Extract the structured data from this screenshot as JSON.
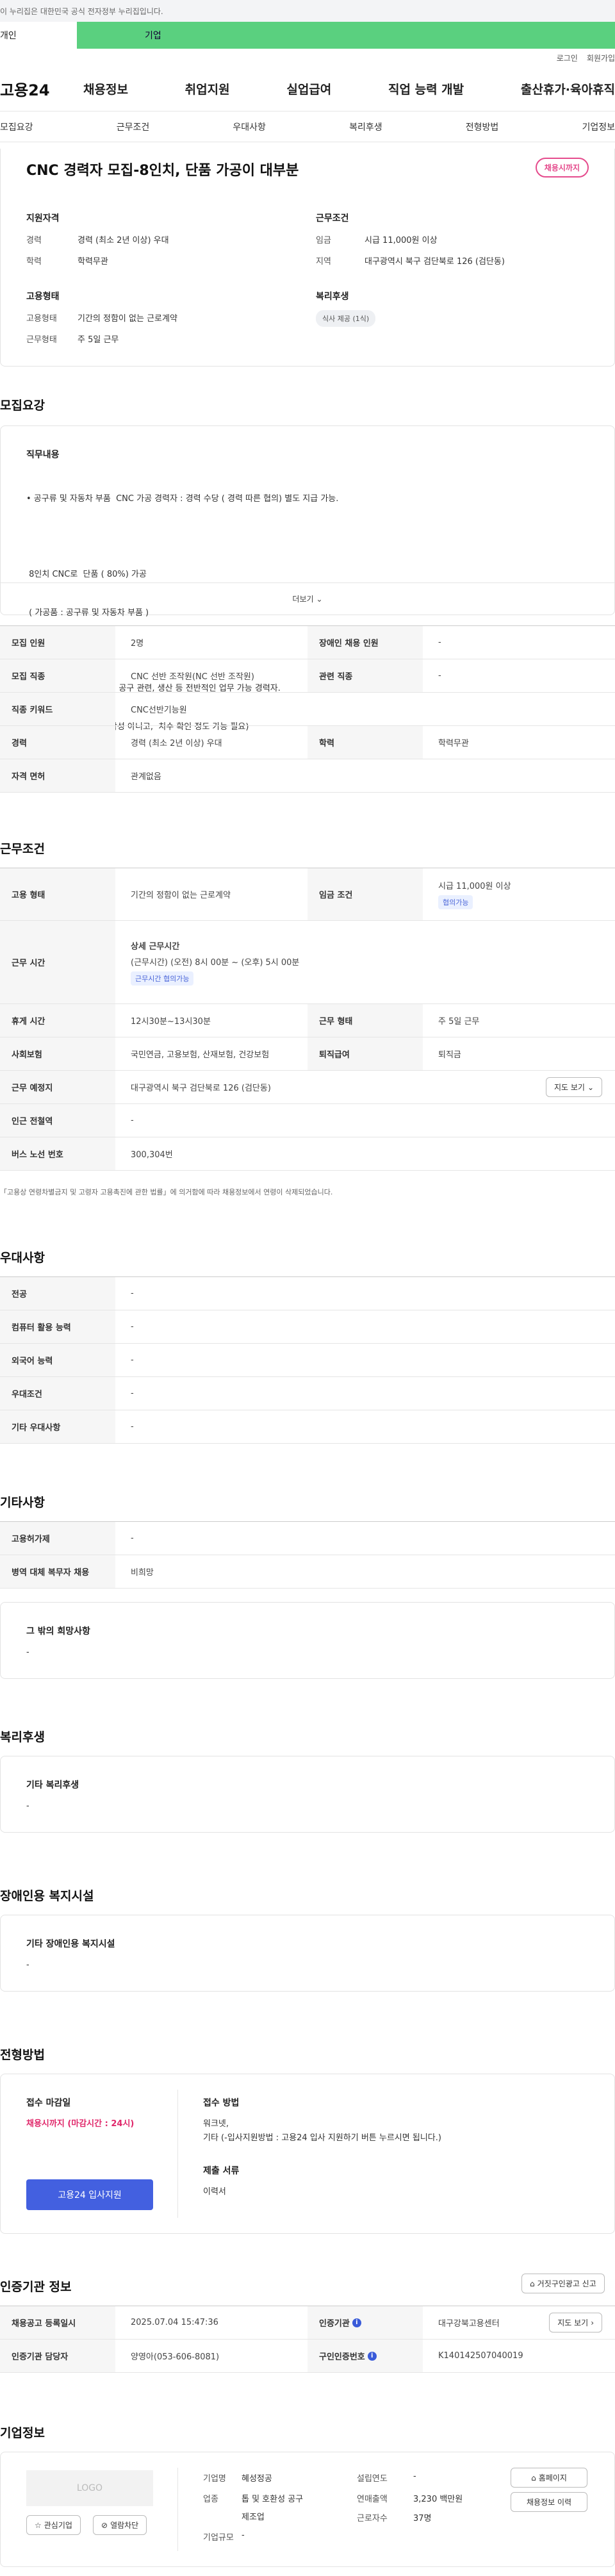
{
  "gov_banner": "이 누리집은 대한민국 공식 전자정부 누리집입니다.",
  "user_tabs": [
    "개인",
    "기업"
  ],
  "util_links": [
    "로그인",
    "회원가입"
  ],
  "logo": "고용24",
  "gnb": [
    "채용정보",
    "취업지원",
    "실업급여",
    "직업 능력 개발",
    "출산휴가·육아휴직"
  ],
  "anchors": [
    "모집요강",
    "근무조건",
    "우대사항",
    "복리후생",
    "전형방법",
    "기업정보"
  ],
  "summary": {
    "title": "CNC 경력자 모집-8인치, 단품 가공이 대부분",
    "badge": "채용시까지",
    "qual_title": "지원자격",
    "qual": [
      {
        "k": "경력",
        "v": "경력 (최소 2년 이상) 우대"
      },
      {
        "k": "학력",
        "v": "학력무관"
      }
    ],
    "cond_title": "근무조건",
    "cond": [
      {
        "k": "임금",
        "v": "시급 11,000원 이상"
      },
      {
        "k": "지역",
        "v": "대구광역시 북구 검단북로 126 (검단동)"
      }
    ],
    "emp_title": "고용형태",
    "emp": [
      {
        "k": "고용형태",
        "v": "기간의 정함이 없는 근로계약"
      },
      {
        "k": "근무형태",
        "v": "주 5일 근무"
      }
    ],
    "welfare_title": "복리후생",
    "welfare_chip": "식사 제공 (1식)"
  },
  "recruit": {
    "title": "모집요강",
    "job_title": "직무내용",
    "job_lines": [
      "• 공구류 및 자동차 부품  CNC 가공 경력자 : 경력 수당 ( 경력 따른 협의) 별도 지급 가능.",
      "",
      " 8인치 CNC로  단품 ( 80%) 가공",
      " ( 가공품 : 공구류 및 자동차 부품 )",
      "",
      " 캐드 도면 활용 프로그램, 공구 관련, 생산 등 전반적인 업무 가능 경력자.",
      " (캐드 활용 정도 : 도면 작성 아니고,  치수 확인 정도 가능 필요)"
    ],
    "more": "더보기",
    "rows": [
      {
        "k1": "모집 인원",
        "v1": "2명",
        "k2": "장애인 채용 인원",
        "v2": "-"
      },
      {
        "k1": "모집 직종",
        "v1": "CNC 선반 조작원(NC 선반 조작원)",
        "k2": "관련 직종",
        "v2": "-"
      },
      {
        "k1": "직종 키워드",
        "v1": "CNC선반기능원"
      },
      {
        "k1": "경력",
        "v1": "경력 (최소 2년 이상) 우대",
        "k2": "학력",
        "v2": "학력무관"
      },
      {
        "k1": "자격 면허",
        "v1": "관계없음"
      }
    ]
  },
  "work": {
    "title": "근무조건",
    "emp_k": "고용 형태",
    "emp_v": "기간의 정함이 없는 근로계약",
    "wage_k": "임금 조건",
    "wage_v": "시급 11,000원 이상",
    "wage_chip": "협의가능",
    "time_k": "근무 시간",
    "time_sub": "상세 근무시간",
    "time_v": "(근무시간) (오전) 8시 00분 ~ (오후) 5시 00분",
    "time_chip": "근무시간 협의가능",
    "break_k": "휴게 시간",
    "break_v": "12시30분~13시30분",
    "type_k": "근무 형태",
    "type_v": "주 5일 근무",
    "ins_k": "사회보험",
    "ins_v": "국민연금, 고용보험, 산재보험, 건강보험",
    "ret_k": "퇴직급여",
    "ret_v": "퇴직금",
    "loc_k": "근무 예정지",
    "loc_v": "대구광역시 북구 검단북로 126 (검단동)",
    "map_btn": "지도 보기",
    "sub_k": "인근 전철역",
    "sub_v": "-",
    "bus_k": "버스 노선 번호",
    "bus_v": "300,304번",
    "note": "「고용상 연령차별금지 및 고령자 고용촉진에 관한 법률」에 의거함에 따라 채용정보에서 연령이 삭제되었습니다."
  },
  "pref": {
    "title": "우대사항",
    "rows": [
      {
        "k": "전공",
        "v": "-"
      },
      {
        "k": "컴퓨터 활용 능력",
        "v": "-"
      },
      {
        "k": "외국어 능력",
        "v": "-"
      },
      {
        "k": "우대조건",
        "v": "-"
      },
      {
        "k": "기타 우대사항",
        "v": "-"
      }
    ]
  },
  "etc": {
    "title": "기타사항",
    "rows": [
      {
        "k": "고용허가제",
        "v": "-"
      },
      {
        "k": "병역 대체 복무자 채용",
        "v": "비희망"
      }
    ],
    "box_title": "그 밖의 희망사항",
    "box_v": "-"
  },
  "welfare": {
    "title": "복리후생",
    "box_title": "기타 복리후생",
    "box_v": "-"
  },
  "disabled": {
    "title": "장애인용 복지시설",
    "box_title": "기타 장애인용 복지시설",
    "box_v": "-"
  },
  "selection": {
    "title": "전형방법",
    "deadline_k": "접수 마감일",
    "deadline_v": "채용시까지 (마감시간 : 24시)",
    "apply_btn": "고용24 입사지원",
    "method_k": "접수 방법",
    "method_v1": "워크넷,",
    "method_v2": "기타 (-입사지원방법 : 고용24 입사 지원하기 버튼 누르시면 됩니다.)",
    "doc_k": "제출 서류",
    "doc_v": "이력서"
  },
  "cert": {
    "title": "인증기관 정보",
    "report_btn": "거짓구인광고 신고",
    "reg_k": "채용공고 등록일시",
    "reg_v": "2025.07.04 15:47:36",
    "org_k": "인증기관",
    "org_v": "대구강북고용센터",
    "map_btn": "지도 보기",
    "mgr_k": "인증기관 담당자",
    "mgr_v": "양영아(053-606-8081)",
    "no_k": "구인인증번호",
    "no_v": "K140142507040019"
  },
  "company": {
    "title": "기업정보",
    "logo_text": "LOGO",
    "fav_btn": "관심기업",
    "block_btn": "열람차단",
    "name_k": "기업명",
    "name_v": "혜성정공",
    "ind_k": "업종",
    "ind_v1": "톱 및 호환성 공구",
    "ind_v2": "제조업",
    "size_k": "기업규모",
    "size_v": "-",
    "year_k": "설립연도",
    "year_v": "-",
    "sales_k": "연매출액",
    "sales_v": "3,230 백만원",
    "emp_k": "근로자수",
    "emp_v": "37명",
    "home_btn": "홈페이지",
    "jobs_btn": "채용정보 이력"
  }
}
